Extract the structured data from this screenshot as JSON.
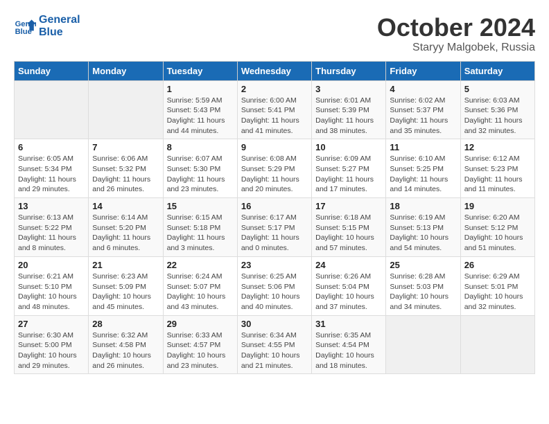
{
  "logo": {
    "line1": "General",
    "line2": "Blue"
  },
  "title": "October 2024",
  "subtitle": "Staryy Malgobek, Russia",
  "days_header": [
    "Sunday",
    "Monday",
    "Tuesday",
    "Wednesday",
    "Thursday",
    "Friday",
    "Saturday"
  ],
  "weeks": [
    [
      {
        "day": "",
        "info": ""
      },
      {
        "day": "",
        "info": ""
      },
      {
        "day": "1",
        "info": "Sunrise: 5:59 AM\nSunset: 5:43 PM\nDaylight: 11 hours\nand 44 minutes."
      },
      {
        "day": "2",
        "info": "Sunrise: 6:00 AM\nSunset: 5:41 PM\nDaylight: 11 hours\nand 41 minutes."
      },
      {
        "day": "3",
        "info": "Sunrise: 6:01 AM\nSunset: 5:39 PM\nDaylight: 11 hours\nand 38 minutes."
      },
      {
        "day": "4",
        "info": "Sunrise: 6:02 AM\nSunset: 5:37 PM\nDaylight: 11 hours\nand 35 minutes."
      },
      {
        "day": "5",
        "info": "Sunrise: 6:03 AM\nSunset: 5:36 PM\nDaylight: 11 hours\nand 32 minutes."
      }
    ],
    [
      {
        "day": "6",
        "info": "Sunrise: 6:05 AM\nSunset: 5:34 PM\nDaylight: 11 hours\nand 29 minutes."
      },
      {
        "day": "7",
        "info": "Sunrise: 6:06 AM\nSunset: 5:32 PM\nDaylight: 11 hours\nand 26 minutes."
      },
      {
        "day": "8",
        "info": "Sunrise: 6:07 AM\nSunset: 5:30 PM\nDaylight: 11 hours\nand 23 minutes."
      },
      {
        "day": "9",
        "info": "Sunrise: 6:08 AM\nSunset: 5:29 PM\nDaylight: 11 hours\nand 20 minutes."
      },
      {
        "day": "10",
        "info": "Sunrise: 6:09 AM\nSunset: 5:27 PM\nDaylight: 11 hours\nand 17 minutes."
      },
      {
        "day": "11",
        "info": "Sunrise: 6:10 AM\nSunset: 5:25 PM\nDaylight: 11 hours\nand 14 minutes."
      },
      {
        "day": "12",
        "info": "Sunrise: 6:12 AM\nSunset: 5:23 PM\nDaylight: 11 hours\nand 11 minutes."
      }
    ],
    [
      {
        "day": "13",
        "info": "Sunrise: 6:13 AM\nSunset: 5:22 PM\nDaylight: 11 hours\nand 8 minutes."
      },
      {
        "day": "14",
        "info": "Sunrise: 6:14 AM\nSunset: 5:20 PM\nDaylight: 11 hours\nand 6 minutes."
      },
      {
        "day": "15",
        "info": "Sunrise: 6:15 AM\nSunset: 5:18 PM\nDaylight: 11 hours\nand 3 minutes."
      },
      {
        "day": "16",
        "info": "Sunrise: 6:17 AM\nSunset: 5:17 PM\nDaylight: 11 hours\nand 0 minutes."
      },
      {
        "day": "17",
        "info": "Sunrise: 6:18 AM\nSunset: 5:15 PM\nDaylight: 10 hours\nand 57 minutes."
      },
      {
        "day": "18",
        "info": "Sunrise: 6:19 AM\nSunset: 5:13 PM\nDaylight: 10 hours\nand 54 minutes."
      },
      {
        "day": "19",
        "info": "Sunrise: 6:20 AM\nSunset: 5:12 PM\nDaylight: 10 hours\nand 51 minutes."
      }
    ],
    [
      {
        "day": "20",
        "info": "Sunrise: 6:21 AM\nSunset: 5:10 PM\nDaylight: 10 hours\nand 48 minutes."
      },
      {
        "day": "21",
        "info": "Sunrise: 6:23 AM\nSunset: 5:09 PM\nDaylight: 10 hours\nand 45 minutes."
      },
      {
        "day": "22",
        "info": "Sunrise: 6:24 AM\nSunset: 5:07 PM\nDaylight: 10 hours\nand 43 minutes."
      },
      {
        "day": "23",
        "info": "Sunrise: 6:25 AM\nSunset: 5:06 PM\nDaylight: 10 hours\nand 40 minutes."
      },
      {
        "day": "24",
        "info": "Sunrise: 6:26 AM\nSunset: 5:04 PM\nDaylight: 10 hours\nand 37 minutes."
      },
      {
        "day": "25",
        "info": "Sunrise: 6:28 AM\nSunset: 5:03 PM\nDaylight: 10 hours\nand 34 minutes."
      },
      {
        "day": "26",
        "info": "Sunrise: 6:29 AM\nSunset: 5:01 PM\nDaylight: 10 hours\nand 32 minutes."
      }
    ],
    [
      {
        "day": "27",
        "info": "Sunrise: 6:30 AM\nSunset: 5:00 PM\nDaylight: 10 hours\nand 29 minutes."
      },
      {
        "day": "28",
        "info": "Sunrise: 6:32 AM\nSunset: 4:58 PM\nDaylight: 10 hours\nand 26 minutes."
      },
      {
        "day": "29",
        "info": "Sunrise: 6:33 AM\nSunset: 4:57 PM\nDaylight: 10 hours\nand 23 minutes."
      },
      {
        "day": "30",
        "info": "Sunrise: 6:34 AM\nSunset: 4:55 PM\nDaylight: 10 hours\nand 21 minutes."
      },
      {
        "day": "31",
        "info": "Sunrise: 6:35 AM\nSunset: 4:54 PM\nDaylight: 10 hours\nand 18 minutes."
      },
      {
        "day": "",
        "info": ""
      },
      {
        "day": "",
        "info": ""
      }
    ]
  ]
}
